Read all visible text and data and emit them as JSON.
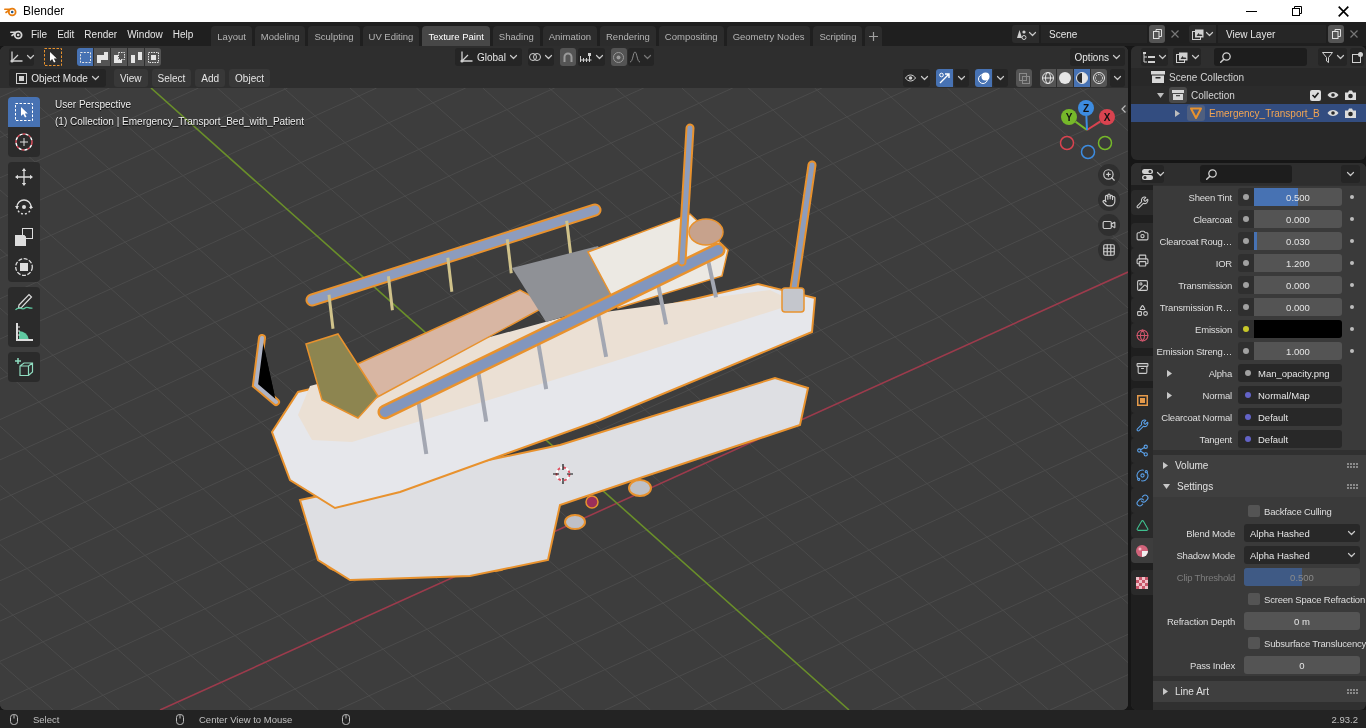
{
  "window": {
    "title": "Blender"
  },
  "menu": [
    "File",
    "Edit",
    "Render",
    "Window",
    "Help"
  ],
  "workspaces": [
    {
      "label": "Layout",
      "selected": false
    },
    {
      "label": "Modeling",
      "selected": false
    },
    {
      "label": "Sculpting",
      "selected": false
    },
    {
      "label": "UV Editing",
      "selected": false
    },
    {
      "label": "Texture Paint",
      "selected": true
    },
    {
      "label": "Shading",
      "selected": false
    },
    {
      "label": "Animation",
      "selected": false
    },
    {
      "label": "Rendering",
      "selected": false
    },
    {
      "label": "Compositing",
      "selected": false
    },
    {
      "label": "Geometry Nodes",
      "selected": false
    },
    {
      "label": "Scripting",
      "selected": false
    }
  ],
  "scene": {
    "value": "Scene"
  },
  "view_layer": {
    "value": "View Layer"
  },
  "tool_header": {
    "select_modes": [
      {
        "selected": true
      },
      {
        "selected": false
      },
      {
        "selected": false
      },
      {
        "selected": false
      },
      {
        "selected": false
      }
    ],
    "transform_orientation": "Global",
    "snap": {
      "on": false
    },
    "proportional_editing": {
      "on": false
    },
    "options": "Options"
  },
  "viewport_header": {
    "mode": "Object Mode",
    "menus": [
      "View",
      "Select",
      "Add",
      "Object"
    ],
    "gizmos": {
      "on": true
    },
    "overlays": {
      "on": true
    },
    "xray": {
      "on": false
    },
    "shading": [
      {
        "selected": false
      },
      {
        "selected": false
      },
      {
        "selected": true
      },
      {
        "selected": false
      }
    ]
  },
  "viewport": {
    "view_name": "User Perspective",
    "object_info": "(1) Collection | Emergency_Transport_Bed_with_Patient",
    "tools": [
      {
        "selected": true
      },
      {
        "selected": false
      },
      {
        "selected": false
      },
      {
        "selected": false
      },
      {
        "selected": false
      },
      {
        "selected": false
      },
      {
        "selected": false
      },
      {
        "selected": false
      },
      {
        "selected": false
      }
    ],
    "gizmo_axes": [
      "X",
      "Y",
      "Z"
    ]
  },
  "outliner": {
    "tree": [
      {
        "label": "Scene Collection",
        "selected": false,
        "children": [
          {
            "label": "Collection",
            "selected": false,
            "expanded": true,
            "checked": true,
            "visible": true,
            "renderable": true,
            "children": [
              {
                "label": "Emergency_Transport_B",
                "selected": true,
                "expanded": false,
                "visible": true,
                "renderable": true
              }
            ]
          }
        ]
      }
    ]
  },
  "properties": {
    "tabs": [
      {
        "selected": false
      },
      {
        "selected": false
      },
      {
        "selected": false
      },
      {
        "selected": false
      },
      {
        "selected": false
      },
      {
        "selected": false
      },
      {
        "selected": false
      },
      {
        "selected": false
      },
      {
        "selected": false
      },
      {
        "selected": false
      },
      {
        "selected": false
      },
      {
        "selected": false
      },
      {
        "selected": false
      },
      {
        "selected": true
      },
      {
        "selected": false
      }
    ],
    "inputs": [
      {
        "kind": "slider",
        "label": "Sheen Tint",
        "value": "0.500",
        "level": 0.5,
        "color": "#a1a1a1"
      },
      {
        "kind": "number",
        "label": "Clearcoat",
        "value": "0.000",
        "color": "#a1a1a1"
      },
      {
        "kind": "slider",
        "label": "Clearcoat Roug…",
        "value": "0.030",
        "level": 0.03,
        "color": "#a1a1a1"
      },
      {
        "kind": "number",
        "label": "IOR",
        "value": "1.200",
        "color": "#a1a1a1"
      },
      {
        "kind": "number",
        "label": "Transmission",
        "value": "0.000",
        "color": "#a1a1a1"
      },
      {
        "kind": "number",
        "label": "Transmission R…",
        "value": "0.000",
        "color": "#a1a1a1"
      },
      {
        "kind": "swatch",
        "label": "Emission",
        "swatch": {
          "color": "#000000"
        },
        "color": "#c7c729"
      },
      {
        "kind": "number",
        "label": "Emission Streng…",
        "value": "1.000",
        "color": "#a1a1a1"
      },
      {
        "kind": "link",
        "label": "Alpha",
        "value": "Man_opacity.png",
        "expanded": false,
        "color": "#a1a1a1"
      },
      {
        "kind": "link",
        "label": "Normal",
        "value": "Normal/Map",
        "expanded": false,
        "color": "#6363c7"
      },
      {
        "kind": "link",
        "label": "Clearcoat Normal",
        "value": "Default",
        "color": "#6363c7"
      },
      {
        "kind": "link",
        "label": "Tangent",
        "value": "Default",
        "color": "#6363c7"
      }
    ],
    "panels": [
      {
        "title": "Volume",
        "expanded": false
      },
      {
        "title": "Settings",
        "expanded": true,
        "rows": [
          {
            "kind": "checkbox",
            "label": "Backface Culling",
            "checked": false,
            "disabled": false
          },
          {
            "kind": "dropdown",
            "label": "Blend Mode",
            "value": "Alpha Hashed",
            "disabled": false
          },
          {
            "kind": "dropdown",
            "label": "Shadow Mode",
            "value": "Alpha Hashed",
            "disabled": false
          },
          {
            "kind": "slider",
            "label": "Clip Threshold",
            "value": "0.500",
            "level": 0.5,
            "disabled": true
          },
          {
            "kind": "checkbox",
            "label": "Screen Space Refraction",
            "checked": false,
            "disabled": false
          },
          {
            "kind": "number",
            "label": "Refraction Depth",
            "value": "0 m",
            "disabled": false
          },
          {
            "kind": "checkbox",
            "label": "Subsurface Translucency",
            "checked": false,
            "disabled": false
          },
          {
            "kind": "number",
            "label": "Pass Index",
            "value": "0",
            "disabled": false
          }
        ]
      },
      {
        "title": "Line Art",
        "expanded": false
      }
    ]
  },
  "status_bar": {
    "hints": [
      {
        "text": "Select"
      },
      {
        "text": "Center View to Mouse"
      }
    ],
    "version": "2.93.2"
  }
}
